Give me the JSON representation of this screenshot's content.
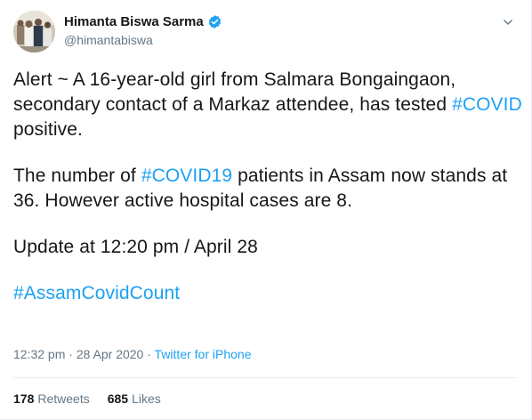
{
  "author": {
    "name": "Himanta Biswa Sarma",
    "handle": "@himantabiswa",
    "verified_icon": "verified-badge-icon",
    "avatar_icon": "profile-photo"
  },
  "menu": {
    "icon": "chevron-down-icon"
  },
  "tweet": {
    "p1": {
      "t1": "Alert ~ A 16-year-old girl from Salmara Bongaingaon, secondary contact of a Markaz attendee, has tested ",
      "h1": "#COVID",
      "t2": " positive."
    },
    "p2": {
      "t1": "The number of ",
      "h1": "#COVID19",
      "t2": " patients in Assam now stands at 36. However active hospital cases are 8."
    },
    "p3": {
      "t1": "Update at 12:20 pm / April 28"
    },
    "p4": {
      "h1": "#AssamCovidCount"
    }
  },
  "meta": {
    "time": "12:32 pm",
    "separator1": " · ",
    "date": "28 Apr 2020",
    "separator2": " · ",
    "source": "Twitter for iPhone"
  },
  "stats": {
    "retweets_count": "178",
    "retweets_label": "Retweets",
    "likes_count": "685",
    "likes_label": "Likes"
  },
  "colors": {
    "link": "#1da1f2",
    "text": "#14171a",
    "muted": "#657786",
    "border": "#e6ecf0"
  }
}
